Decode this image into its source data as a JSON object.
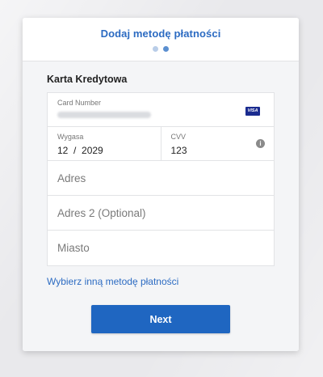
{
  "header": {
    "title": "Dodaj metodę płatności",
    "steps_total": 2,
    "step_current": 2
  },
  "section": {
    "title": "Karta Kredytowa"
  },
  "card_number": {
    "label": "Card Number",
    "value_masked": true,
    "brand": "VISA"
  },
  "expiry": {
    "label": "Wygasa",
    "value": "12  /  2029"
  },
  "cvv": {
    "label": "CVV",
    "value": "123",
    "info_icon": "info-icon"
  },
  "address1": {
    "placeholder": "Adres"
  },
  "address2": {
    "placeholder": "Adres 2 (Optional)"
  },
  "city": {
    "placeholder": "Miasto"
  },
  "alt_method_link": "Wybierz inną metodę płatności",
  "next_button": "Next",
  "colors": {
    "accent": "#2c6bc2",
    "button": "#1f66c1",
    "visa": "#1a2b8f"
  }
}
